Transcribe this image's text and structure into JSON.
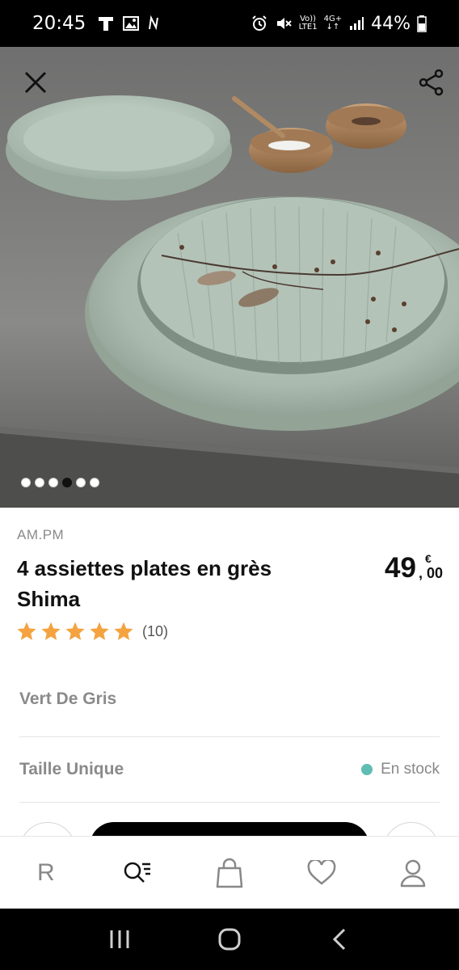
{
  "status_bar": {
    "time": "20:45",
    "network_top": "Vo))",
    "network_bottom": "LTE1",
    "network_type": "4G+",
    "battery": "44%"
  },
  "hero": {
    "carousel_total": 6,
    "carousel_active_index": 3
  },
  "product": {
    "brand": "AM.PM",
    "title": "4 assiettes plates en grès Shima",
    "price_integer": "49",
    "price_currency": "€",
    "price_decimal": ", 00",
    "rating_stars": 5,
    "rating_count": "(10)"
  },
  "options": {
    "color_label": "Vert De Gris",
    "size_label": "Taille Unique",
    "stock_label": "En stock",
    "stock_color": "#5fbdb3"
  },
  "bottom_nav": {
    "home_label": "R",
    "icons": [
      "search-list-icon",
      "bag-icon",
      "heart-icon",
      "user-icon"
    ]
  },
  "colors": {
    "star": "#f4a340",
    "accent_button": "#000000"
  }
}
